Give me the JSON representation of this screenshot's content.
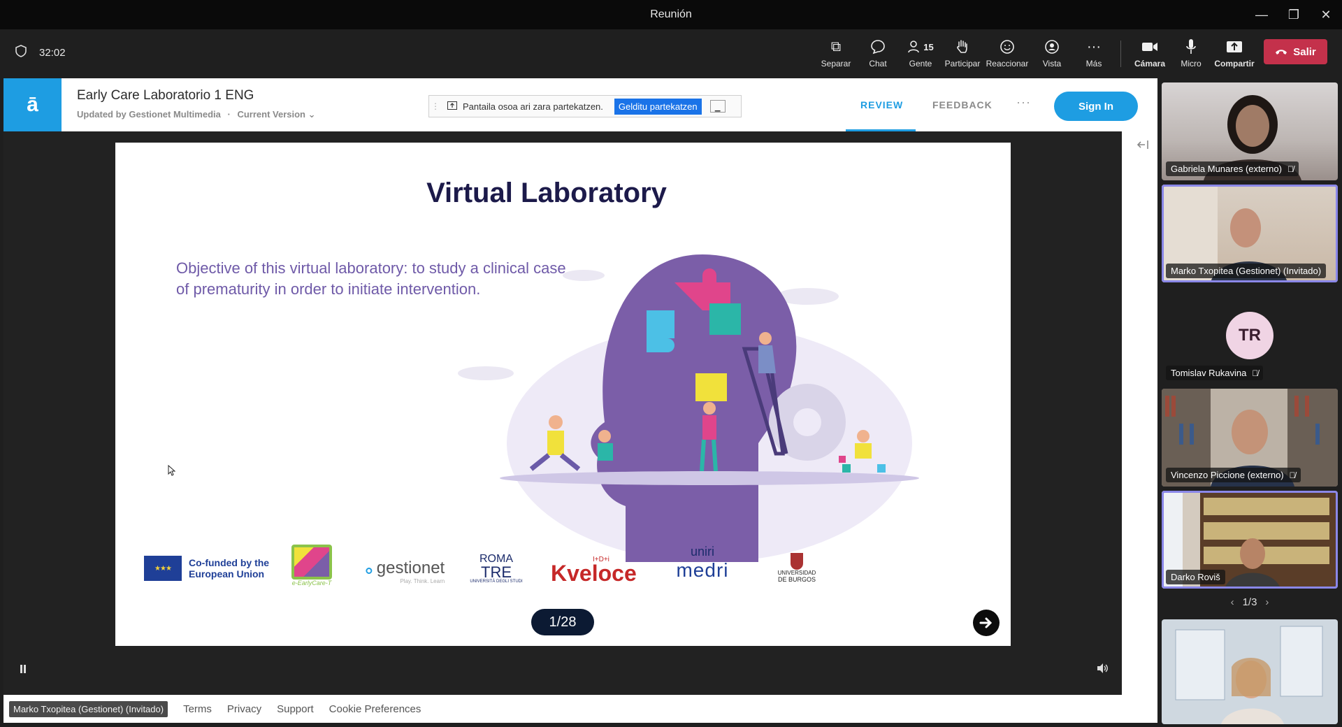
{
  "window": {
    "title": "Reunión",
    "min": "—",
    "restore": "❐",
    "close": "✕"
  },
  "meeting": {
    "timer": "32:02",
    "tools": [
      {
        "label": "Separar",
        "icon": "popout-icon",
        "glyph": "⧉"
      },
      {
        "label": "Chat",
        "icon": "chat-icon",
        "glyph": "💬"
      },
      {
        "label": "Gente",
        "icon": "people-icon",
        "glyph": "👤",
        "count": "15"
      },
      {
        "label": "Participar",
        "icon": "raise-hand-icon",
        "glyph": "✋"
      },
      {
        "label": "Reaccionar",
        "icon": "smiley-icon",
        "glyph": "☺"
      },
      {
        "label": "Vista",
        "icon": "view-icon",
        "glyph": "◉"
      },
      {
        "label": "Más",
        "icon": "more-icon",
        "glyph": "···"
      },
      {
        "label": "Cámara",
        "icon": "camera-icon",
        "glyph": "■"
      },
      {
        "label": "Micro",
        "icon": "microphone-icon",
        "glyph": "🎤"
      },
      {
        "label": "Compartir",
        "icon": "share-icon",
        "glyph": "⇪"
      }
    ],
    "leave_label": "Salir"
  },
  "app": {
    "logo": "ā",
    "doc_title": "Early Care Laboratorio 1 ENG",
    "doc_updated": "Updated by Gestionet Multimedia",
    "doc_sep": "·",
    "doc_version": "Current Version ⌄",
    "share_banner_text": "Pantaila osoa ari zara partekatzen.",
    "share_banner_stop": "Gelditu partekatzen",
    "nav_review": "REVIEW",
    "nav_feedback": "FEEDBACK",
    "nav_more": "···",
    "signin": "Sign In"
  },
  "slide": {
    "title": "Virtual Laboratory",
    "text": "Objective of this virtual laboratory: to study a clinical case of prematurity in order to initiate intervention.",
    "logos": {
      "eu": "Co-funded by the European Union",
      "earlycare": "e-EarlyCare-T",
      "gestionet": "gestionet",
      "gestionet_tag": "Play. Think. Learn",
      "roma_top": "ROMA",
      "roma_bottom": "TRE",
      "roma_sub": "UNIVERSITÀ DEGLI STUDI",
      "kveloce": "Kveloce",
      "kveloce_sup": "I+D+i",
      "uniri": "uniri",
      "medri": "medri",
      "burgos_top": "UNIVERSIDAD",
      "burgos_bottom": "DE BURGOS"
    },
    "pager": "1/28"
  },
  "footer": {
    "nametag": "Marko Txopitea (Gestionet) (Invitado)",
    "links": [
      "Terms",
      "Privacy",
      "Support",
      "Cookie Preferences"
    ]
  },
  "participants": [
    {
      "name": "Gabriela Munares (externo)",
      "muted": true
    },
    {
      "name": "Marko Txopitea (Gestionet) (Invitado)",
      "muted": false,
      "active": true
    },
    {
      "name": "Tomislav Rukavina",
      "muted": true,
      "initials": "TR"
    },
    {
      "name": "Vincenzo Piccione (externo)",
      "muted": true
    },
    {
      "name": "Darko Roviš",
      "muted": false,
      "active": true
    }
  ],
  "tiles_pager": "1/3"
}
